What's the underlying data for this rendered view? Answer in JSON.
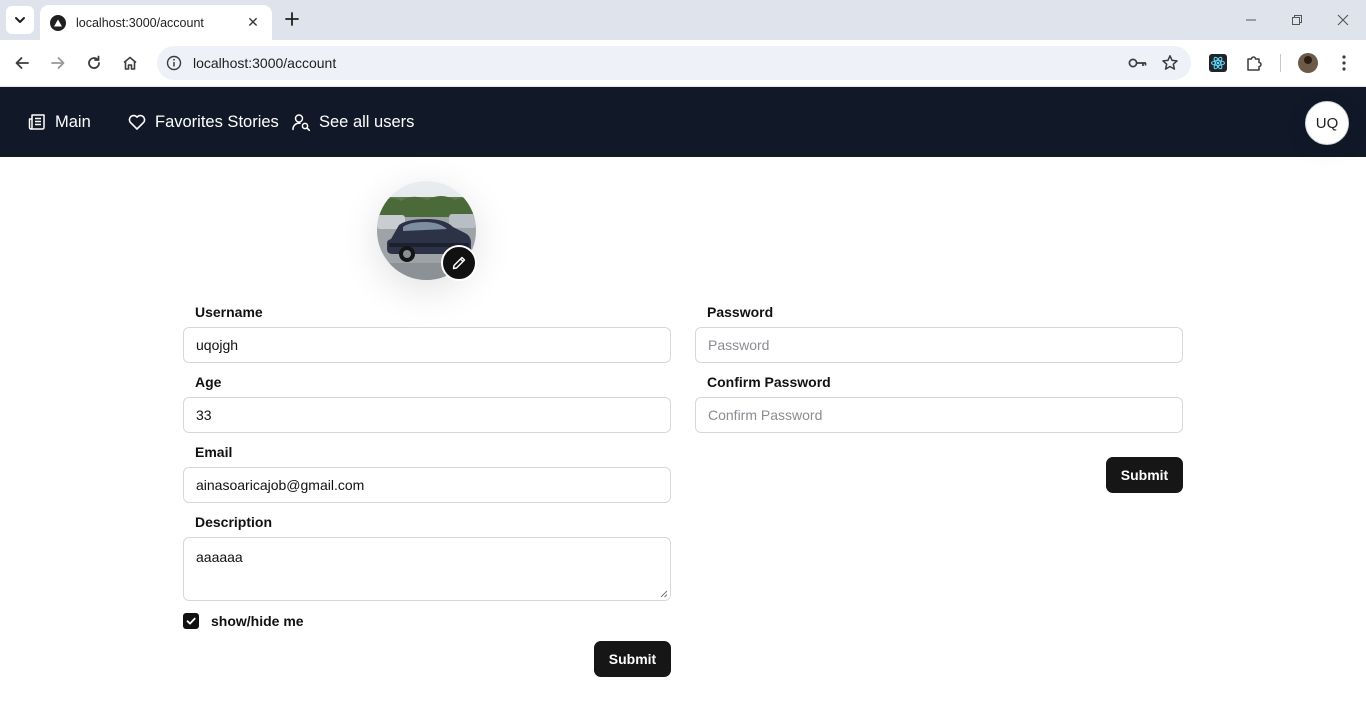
{
  "browser": {
    "tab_title": "localhost:3000/account",
    "url": "localhost:3000/account",
    "close_glyph": "✕"
  },
  "nav": {
    "main_label": "Main",
    "favorites_label": "Favorites Stories",
    "users_label": "See all users",
    "user_initials": "UQ",
    "bg_color": "#111827"
  },
  "profile_form": {
    "username_label": "Username",
    "username_value": "uqojgh",
    "age_label": "Age",
    "age_value": "33",
    "email_label": "Email",
    "email_value": "ainasoaricajob@gmail.com",
    "description_label": "Description",
    "description_value": "aaaaaa",
    "visibility_label": "show/hide me",
    "visibility_checked": true,
    "submit_label": "Submit"
  },
  "password_form": {
    "password_label": "Password",
    "password_placeholder": "Password",
    "confirm_label": "Confirm Password",
    "confirm_placeholder": "Confirm Password",
    "submit_label": "Submit"
  },
  "icons": {
    "tab_menu": "chevron-down-icon",
    "favicon": "triangle-logo-icon",
    "new_tab": "plus-icon",
    "back": "arrow-left-icon",
    "forward": "arrow-right-icon",
    "reload": "reload-icon",
    "home": "home-icon",
    "site_info": "info-icon",
    "password_manager": "key-icon",
    "bookmark": "star-icon",
    "react_devtools": "react-icon",
    "extensions": "puzzle-icon",
    "menu": "kebab-menu-icon",
    "main_nav": "newspaper-icon",
    "favorites_nav": "heart-icon",
    "users_nav": "user-search-icon",
    "edit_avatar": "pencil-icon"
  }
}
